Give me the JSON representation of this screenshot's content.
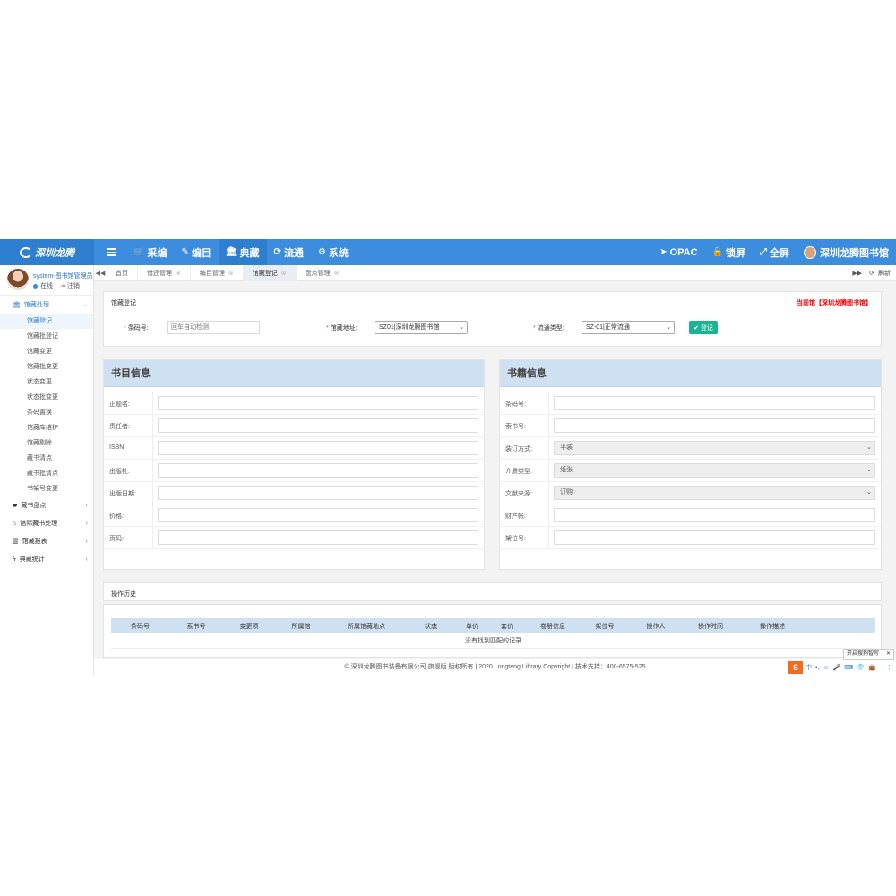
{
  "logo": {
    "text": "深圳龙腾"
  },
  "topnav": [
    {
      "icon": "cart-icon",
      "glyph": "🛒",
      "label": "采编"
    },
    {
      "icon": "edit-icon",
      "glyph": "✎",
      "label": "编目"
    },
    {
      "icon": "bank-icon",
      "glyph": "🏛",
      "label": "典藏"
    },
    {
      "icon": "refresh-icon",
      "glyph": "⟳",
      "label": "流通"
    },
    {
      "icon": "gears-icon",
      "glyph": "⚙",
      "label": "系统"
    }
  ],
  "rightnav": {
    "opac": "OPAC",
    "lock": "锁屏",
    "fullscreen": "全屏",
    "library": "深圳龙腾图书馆"
  },
  "user": {
    "name": "system-图书馆管理员",
    "status": "在线",
    "logout": "注销"
  },
  "sidebar": {
    "group_open": "馆藏处理",
    "items": [
      "馆藏登记",
      "馆藏批登记",
      "馆藏变更",
      "馆藏批变更",
      "状态变更",
      "状态批变更",
      "条码置换",
      "馆藏库维护",
      "馆藏剔除",
      "藏书清点",
      "藏书批清点",
      "书架号变更"
    ],
    "groups": [
      {
        "icon": "book-icon",
        "glyph": "▰",
        "label": "藏书盘点"
      },
      {
        "icon": "home-icon",
        "glyph": "⌂",
        "label": "馆际藏书处理"
      },
      {
        "icon": "chart-icon",
        "glyph": "▥",
        "label": "馆藏报表"
      },
      {
        "icon": "bolt-icon",
        "glyph": "ϟ",
        "label": "典藏统计"
      }
    ]
  },
  "tabs": [
    {
      "label": "首页",
      "closable": false
    },
    {
      "label": "借还管理",
      "closable": true
    },
    {
      "label": "编目管理",
      "closable": true
    },
    {
      "label": "馆藏登记",
      "closable": true
    },
    {
      "label": "盘点管理",
      "closable": true
    }
  ],
  "tabs_right": {
    "refresh": "刷新"
  },
  "register": {
    "title": "馆藏登记",
    "current_lib": "当前馆【深圳龙腾图书馆】",
    "barcode_label": "条码号:",
    "barcode_placeholder": "回车自动检测",
    "location_label": "馆藏地址:",
    "location_value": "SZ01|深圳龙腾图书馆",
    "circ_label": "流通类型:",
    "circ_value": "SZ-01|正常流通",
    "submit": "登记"
  },
  "biblio": {
    "title": "书目信息",
    "fields": [
      "正题名:",
      "责任者:",
      "ISBN:",
      "出版社:",
      "出版日期:",
      "价格:",
      "页码:"
    ]
  },
  "book": {
    "title": "书籍信息",
    "fields": [
      {
        "label": "条码号:",
        "value": ""
      },
      {
        "label": "索书号:",
        "value": ""
      },
      {
        "label": "装订方式:",
        "value": "平装",
        "select": true
      },
      {
        "label": "介质类型:",
        "value": "纸张",
        "select": true
      },
      {
        "label": "文献来源:",
        "value": "订购",
        "select": true
      },
      {
        "label": "财产帐:",
        "value": ""
      },
      {
        "label": "架位号:",
        "value": ""
      }
    ]
  },
  "history": {
    "title": "操作历史",
    "columns": [
      "条码号",
      "索书号",
      "变更项",
      "所属馆",
      "所属馆藏地点",
      "状态",
      "单价",
      "套价",
      "卷册信息",
      "架位号",
      "操作人",
      "操作时间",
      "操作描述"
    ],
    "empty": "没有找到匹配的记录"
  },
  "footer": "© 深圳龙腾图书装备有限公司 旗舰版 版权所有 | 2020 Longteng Library Copyright | 技术支持：400-6575-525",
  "ime": {
    "logo": "S",
    "items": [
      "中",
      "•,",
      "☺",
      "🎤",
      "⌨",
      "👕",
      "👜",
      "⋮⋮"
    ]
  },
  "tooltip": "开启搜狗智写"
}
